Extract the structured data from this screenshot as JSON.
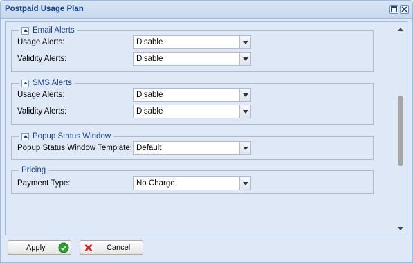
{
  "window": {
    "title": "Postpaid Usage Plan",
    "tools": [
      "maximize-icon",
      "close-icon"
    ]
  },
  "sections": {
    "email": {
      "title": "Email Alerts",
      "usage_label": "Usage Alerts:",
      "usage_value": "Disable",
      "validity_label": "Validity Alerts:",
      "validity_value": "Disable"
    },
    "sms": {
      "title": "SMS Alerts",
      "usage_label": "Usage Alerts:",
      "usage_value": "Disable",
      "validity_label": "Validity Alerts:",
      "validity_value": "Disable"
    },
    "popup": {
      "title": "Popup Status Window",
      "template_label": "Popup Status Window Template:",
      "template_value": "Default"
    },
    "pricing": {
      "title": "Pricing",
      "payment_label": "Payment Type:",
      "payment_value": "No Charge"
    }
  },
  "buttons": {
    "apply": "Apply",
    "cancel": "Cancel"
  },
  "colors": {
    "accent": "#15428b",
    "panel": "#dfe8f6",
    "apply_icon": "#2e9e2e",
    "cancel_icon": "#d62b2b"
  }
}
